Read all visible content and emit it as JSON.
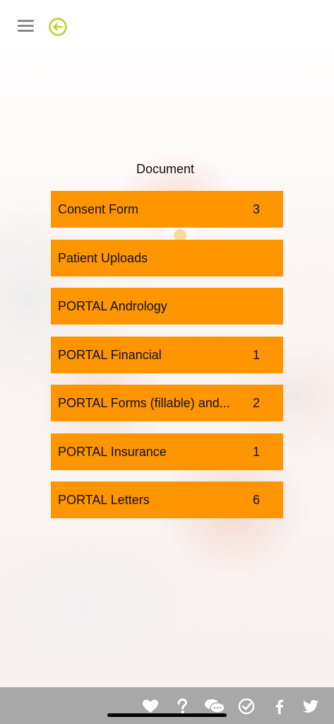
{
  "header": {
    "menu_icon": "hamburger-menu-icon",
    "back_icon": "circle-arrow-left-icon",
    "accent_color": "#b8cf2e"
  },
  "page": {
    "title": "Document"
  },
  "documents": [
    {
      "label": "Consent Form",
      "count": "3"
    },
    {
      "label": "Patient Uploads",
      "count": ""
    },
    {
      "label": "PORTAL Andrology",
      "count": ""
    },
    {
      "label": "PORTAL Financial",
      "count": "1"
    },
    {
      "label": "PORTAL Forms (fillable) and...",
      "count": "2"
    },
    {
      "label": "PORTAL Insurance",
      "count": "1"
    },
    {
      "label": "PORTAL Letters",
      "count": "6"
    }
  ],
  "item_color": "#ff9500",
  "bottom_bar": {
    "icons": [
      "heart-icon",
      "question-icon",
      "chat-bubbles-icon",
      "check-circle-icon",
      "facebook-icon",
      "twitter-icon"
    ]
  }
}
